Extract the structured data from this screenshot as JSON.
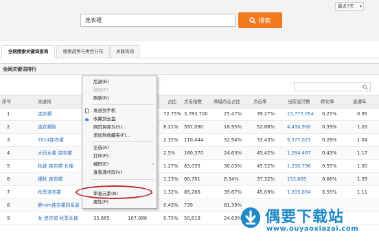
{
  "search": {
    "query": "连衣裙",
    "button_label": "搜索",
    "period": "最近7天"
  },
  "tabs": [
    {
      "label": "全网搜索关键词查询",
      "active": true
    },
    {
      "label": "搜索趋势与类目分布",
      "active": false
    },
    {
      "label": "关联热词",
      "active": false
    }
  ],
  "panel": {
    "title": "全网关键词排行"
  },
  "table": {
    "headers": [
      "序号",
      "关键词",
      "搜索指数",
      "",
      "占比",
      "点击指数",
      "商城点击占比",
      "点击率",
      "当前宝贝数",
      "转化率",
      "直通车"
    ],
    "rows": [
      {
        "index": "1",
        "keyword": "连衣裙",
        "c3": "",
        "c4": "",
        "share": "72.75%",
        "clicks": "3,783,700",
        "mall": "25.47%",
        "ctr": "39.27%",
        "items": "15,777,054",
        "conv": "0.25%",
        "ztc": "0.95"
      },
      {
        "index": "2",
        "keyword": "连衣裙秋",
        "c3": "",
        "c4": "",
        "share": "8.21%",
        "clicks": "597,090",
        "mall": "18.95%",
        "ctr": "52.88%",
        "items": "4,430,930",
        "conv": "0.39%",
        "ztc": "1.03"
      },
      {
        "index": "3",
        "keyword": "2014连衣裙",
        "c3": "",
        "c4": "",
        "share": "2.32%",
        "clicks": "110,444",
        "mall": "32.94%",
        "ctr": "33.43%",
        "items": "9,377,023",
        "conv": "0.28%",
        "ztc": "1.04"
      },
      {
        "index": "4",
        "keyword": "大码女装 连衣裙",
        "c3": "",
        "c4": "",
        "share": "2.5%",
        "clicks": "160,370",
        "mall": "24.63%",
        "ctr": "45.42%",
        "items": "1,284,497",
        "conv": "0.43%",
        "ztc": "1.17"
      },
      {
        "index": "5",
        "keyword": "秋装 连衣裙 长袖",
        "c3": "",
        "c4": "",
        "share": "1.27%",
        "clicks": "83,035",
        "mall": "30.03%",
        "ctr": "45.52%",
        "items": "1,230,796",
        "conv": "0.55%",
        "ztc": "1.00"
      },
      {
        "index": "6",
        "keyword": "裙秋 连衣裙",
        "c3": "",
        "c4": "",
        "share": "1.13%",
        "clicks": "60,701",
        "mall": "8.34%",
        "ctr": "37.32%",
        "items": "153,669",
        "conv": "0.66%",
        "ztc": "1.09"
      },
      {
        "index": "7",
        "keyword": "秋季连衣裙",
        "c3": "",
        "c4": "",
        "share": "1.32%",
        "clicks": "85,286",
        "mall": "39.67%",
        "ctr": "45.09%",
        "items": "1,205,894",
        "conv": "0.55%",
        "ztc": "1.11"
      },
      {
        "index": "8",
        "keyword": "胖mm连衣裙四系装",
        "c3": "",
        "c4": "",
        "share": "0.43%",
        "clicks": "739",
        "mall": "81.39%",
        "ctr": "",
        "items": "",
        "conv": "",
        "ztc": ""
      },
      {
        "index": "9",
        "keyword": "女 连衣裙 秋季长袖",
        "c3": "35,865",
        "c4": "107,088",
        "share": "0.75%",
        "clicks": "50,819",
        "mall": "24.63%",
        "ctr": "",
        "items": "",
        "conv": "",
        "ztc": ""
      }
    ]
  },
  "context_menu": {
    "items": [
      {
        "label": "后退(B)",
        "disabled": false
      },
      {
        "label": "前进(F)",
        "disabled": true
      },
      {
        "label": "刷新(R)",
        "disabled": false
      },
      {
        "label": "发送到手机",
        "disabled": false
      },
      {
        "label": "收藏到云盘",
        "disabled": false
      },
      {
        "label": "网页另存为(S)...",
        "disabled": false
      },
      {
        "label": "添加到收藏夹(F)...",
        "disabled": false
      },
      {
        "label": "全选(A)",
        "disabled": false
      },
      {
        "label": "打印(P)...",
        "disabled": false
      },
      {
        "label": "编码(E)",
        "disabled": false
      },
      {
        "label": "查看源代码(V)",
        "disabled": false
      },
      {
        "label": "审查元素(N)",
        "disabled": false
      },
      {
        "label": "属性(P)",
        "disabled": false
      }
    ]
  },
  "watermark": {
    "title": "偶要下载站",
    "url": "www.ouyaoxiazai.com"
  },
  "colors": {
    "accent": "#f27a1d",
    "link": "#2a6ebb",
    "highlight": "#c0292b",
    "watermark": "#1e88c8"
  }
}
